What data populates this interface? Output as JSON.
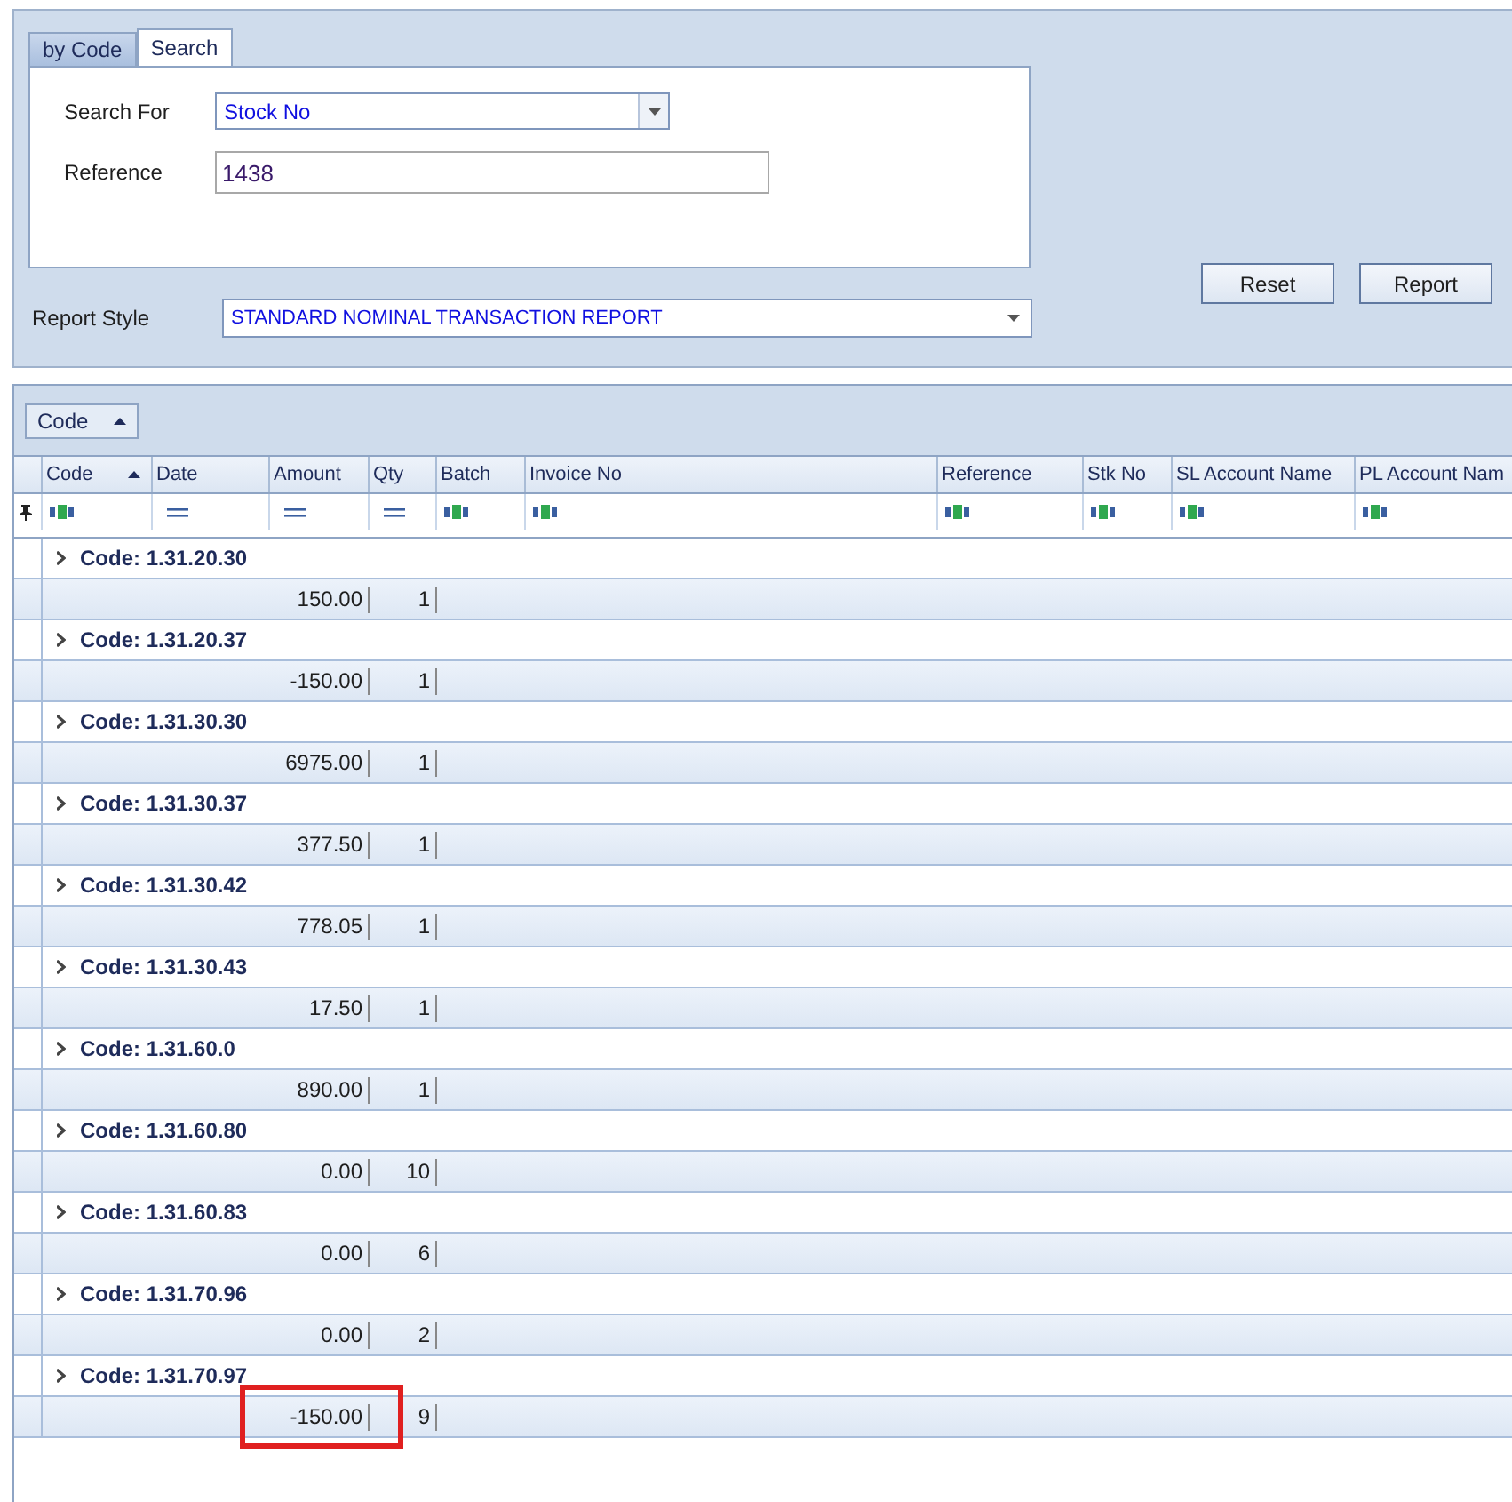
{
  "tabs": [
    {
      "label": "by Code",
      "selected": false
    },
    {
      "label": "Search",
      "selected": true
    }
  ],
  "search_for": {
    "label": "Search For",
    "value": "Stock No"
  },
  "reference": {
    "label": "Reference",
    "value": "1438"
  },
  "report_style": {
    "label": "Report Style",
    "value": "STANDARD NOMINAL TRANSACTION REPORT"
  },
  "buttons": [
    "Reset",
    "Report"
  ],
  "group_by": {
    "label": "Code",
    "sorted": true
  },
  "columns": [
    {
      "label": "Code",
      "sorted": true
    },
    {
      "label": "Date",
      "sorted": false
    },
    {
      "label": "Amount",
      "sorted": false
    },
    {
      "label": "Qty",
      "sorted": false
    },
    {
      "label": "Batch",
      "sorted": false
    },
    {
      "label": "Invoice No",
      "sorted": false
    },
    {
      "label": "Reference",
      "sorted": false
    },
    {
      "label": "Stk No",
      "sorted": false
    },
    {
      "label": "SL Account Name",
      "sorted": false
    },
    {
      "label": "PL Account Nam",
      "sorted": false
    }
  ],
  "filters": [
    {
      "kind": "text"
    },
    {
      "kind": "equals"
    },
    {
      "kind": "equals"
    },
    {
      "kind": "equals"
    },
    {
      "kind": "text"
    },
    {
      "kind": "text"
    },
    {
      "kind": "text"
    },
    {
      "kind": "text"
    },
    {
      "kind": "text"
    },
    {
      "kind": "text"
    }
  ],
  "groups": [
    {
      "label": "Code: 1.31.20.30",
      "amount": "150.00",
      "qty": "1",
      "highlighted": false
    },
    {
      "label": "Code: 1.31.20.37",
      "amount": "-150.00",
      "qty": "1",
      "highlighted": false
    },
    {
      "label": "Code: 1.31.30.30",
      "amount": "6975.00",
      "qty": "1",
      "highlighted": false
    },
    {
      "label": "Code: 1.31.30.37",
      "amount": "377.50",
      "qty": "1",
      "highlighted": false
    },
    {
      "label": "Code: 1.31.30.42",
      "amount": "778.05",
      "qty": "1",
      "highlighted": false
    },
    {
      "label": "Code: 1.31.30.43",
      "amount": "17.50",
      "qty": "1",
      "highlighted": false
    },
    {
      "label": "Code: 1.31.60.0",
      "amount": "890.00",
      "qty": "1",
      "highlighted": false
    },
    {
      "label": "Code: 1.31.60.80",
      "amount": "0.00",
      "qty": "10",
      "highlighted": false
    },
    {
      "label": "Code: 1.31.60.83",
      "amount": "0.00",
      "qty": "6",
      "highlighted": false
    },
    {
      "label": "Code: 1.31.70.96",
      "amount": "0.00",
      "qty": "2",
      "highlighted": false
    },
    {
      "label": "Code: 1.31.70.97",
      "amount": "-150.00",
      "qty": "9",
      "highlighted": true
    }
  ]
}
